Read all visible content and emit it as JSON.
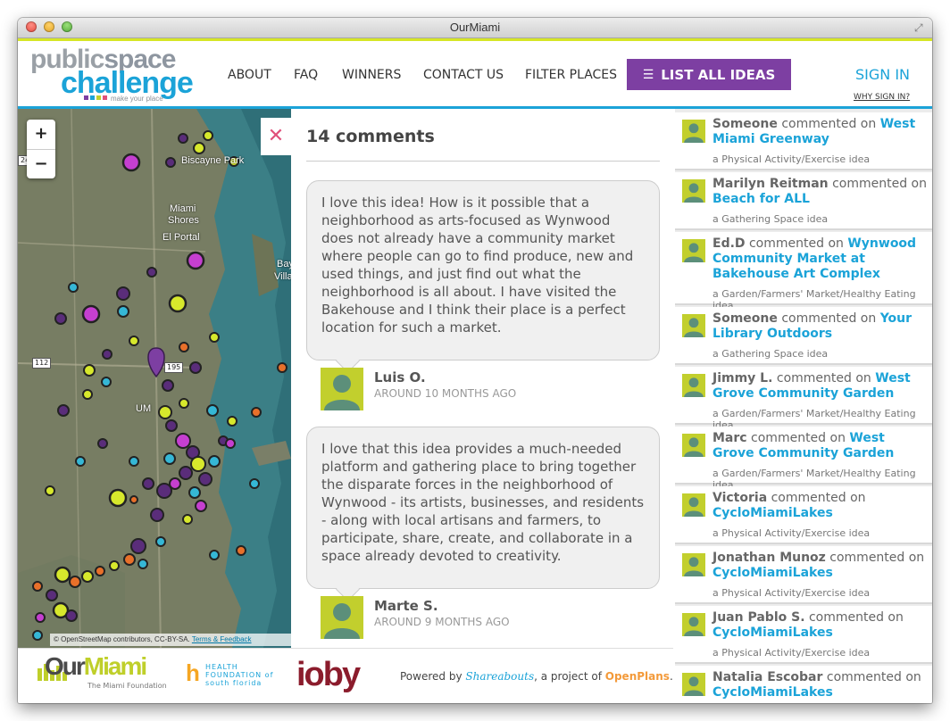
{
  "window": {
    "title": "OurMiami"
  },
  "logo": {
    "line1": "public",
    "line1b": "space",
    "line2": "challenge",
    "tagline": "make your place"
  },
  "nav": {
    "items": [
      "ABOUT",
      "FAQ",
      "WINNERS",
      "CONTACT US",
      "FILTER PLACES"
    ],
    "list_all": "LIST ALL IDEAS",
    "sign_in": "SIGN IN",
    "why_sign_in": "WHY SIGN IN?"
  },
  "map": {
    "zoom_in": "+",
    "zoom_out": "−",
    "labels": [
      "Biscayne Park",
      "Miami",
      "Shores",
      "El Portal",
      "Bay",
      "Villa",
      "UM"
    ],
    "road_shields": [
      "24",
      "112",
      "195"
    ],
    "attribution": "© OpenStreetMap contributors, CC-BY-SA.",
    "attribution_link": "Terms & Feedback"
  },
  "comments": {
    "close": "✕",
    "count_label": "14 comments",
    "items": [
      {
        "text": "I love this idea! How is it possible that a neighborhood as arts-focused as Wynwood does not already have a community market where people can go to find produce, new and used things, and just find out what the neighborhood is all about. I have visited the Bakehouse and I think their place is a perfect location for such a market.",
        "author": "Luis O.",
        "when": "AROUND 10 MONTHS AGO"
      },
      {
        "text": "I love that this idea provides a much-needed platform and gathering place to bring together the disparate forces in the neighborhood of Wynwood - its artists, businesses, and residents - along with local artisans and farmers, to participate, share, create, and collaborate in a space already devoted to creativity.",
        "author": "Marte S.",
        "when": "AROUND 9 MONTHS AGO"
      }
    ]
  },
  "activity": {
    "verb": "commented on",
    "items": [
      {
        "who": "Someone",
        "idea": "West Miami Greenway",
        "category": "a Physical Activity/Exercise idea"
      },
      {
        "who": "Marilyn Reitman",
        "idea": "Beach for ALL",
        "category": "a Gathering Space idea"
      },
      {
        "who": "Ed.D",
        "idea": "Wynwood Community Market at Bakehouse Art Complex",
        "category": "a Garden/Farmers' Market/Healthy Eating idea"
      },
      {
        "who": "Someone",
        "idea": "Your Library Outdoors",
        "category": "a Gathering Space idea"
      },
      {
        "who": "Jimmy L.",
        "idea": "West Grove Community Garden",
        "category": "a Garden/Farmers' Market/Healthy Eating idea"
      },
      {
        "who": "Marc",
        "idea": "West Grove Community Garden",
        "category": "a Garden/Farmers' Market/Healthy Eating idea"
      },
      {
        "who": "Victoria",
        "idea": "CycloMiamiLakes",
        "category": "a Physical Activity/Exercise idea"
      },
      {
        "who": "Jonathan Munoz",
        "idea": "CycloMiamiLakes",
        "category": "a Physical Activity/Exercise idea"
      },
      {
        "who": "Juan Pablo S.",
        "idea": "CycloMiamiLakes",
        "category": "a Physical Activity/Exercise idea"
      },
      {
        "who": "Natalia Escobar",
        "idea": "CycloMiamiLakes",
        "category": ""
      }
    ]
  },
  "footer": {
    "ourmiami": "Our",
    "ourmiami_b": "Miami",
    "ourmiami_sub": "The Miami Foundation",
    "health_foundation": "HEALTH FOUNDATION of south florida",
    "health_mark": "h",
    "ioby": "ioby",
    "powered_prefix": "Powered by",
    "shareabouts": "Shareabouts",
    "project_of": ", a project of",
    "openplans": "OpenPlans",
    "period": "."
  },
  "colors": {
    "accent_blue": "#1ba3d8",
    "purple": "#7d3fa2",
    "lime": "#c2cf2d",
    "close_pink": "#e0507a"
  }
}
